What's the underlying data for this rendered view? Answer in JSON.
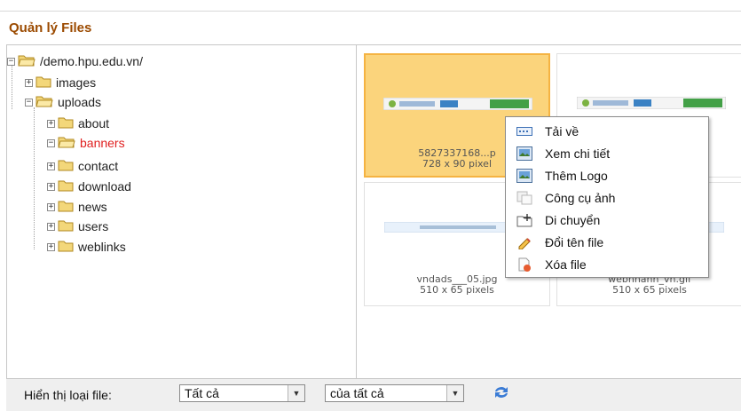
{
  "page": {
    "title": "Quản lý Files"
  },
  "tree": {
    "root": "/demo.hpu.edu.vn/",
    "items": [
      {
        "label": "images"
      },
      {
        "label": "uploads"
      },
      {
        "label": "about"
      },
      {
        "label": "banners"
      },
      {
        "label": "contact"
      },
      {
        "label": "download"
      },
      {
        "label": "news"
      },
      {
        "label": "users"
      },
      {
        "label": "weblinks"
      }
    ]
  },
  "files": [
    {
      "name": "5827337168...p",
      "size": "728 x 90 pixel"
    },
    {
      "name": "",
      "size": ""
    },
    {
      "name": "vndads___05.jpg",
      "size": "510 x 65 pixels"
    },
    {
      "name": "webnhanh_vn.gif",
      "size": "510 x 65 pixels"
    }
  ],
  "context_menu": {
    "items": [
      {
        "label": "Tải về",
        "icon": "download-icon"
      },
      {
        "label": "Xem chi tiết",
        "icon": "view-details-icon"
      },
      {
        "label": "Thêm Logo",
        "icon": "add-logo-icon"
      },
      {
        "label": "Công cụ ảnh",
        "icon": "image-tools-icon"
      },
      {
        "label": "Di chuyển",
        "icon": "move-icon"
      },
      {
        "label": "Đổi tên file",
        "icon": "rename-icon"
      },
      {
        "label": "Xóa file",
        "icon": "delete-icon"
      }
    ]
  },
  "filter": {
    "label": "Hiển thị loại file:",
    "type_value": "Tất cả",
    "owner_value": "của tất cả"
  },
  "colors": {
    "title": "#9b4a00",
    "selected_folder": "#e02020",
    "selected_file": "#fbd47c"
  }
}
